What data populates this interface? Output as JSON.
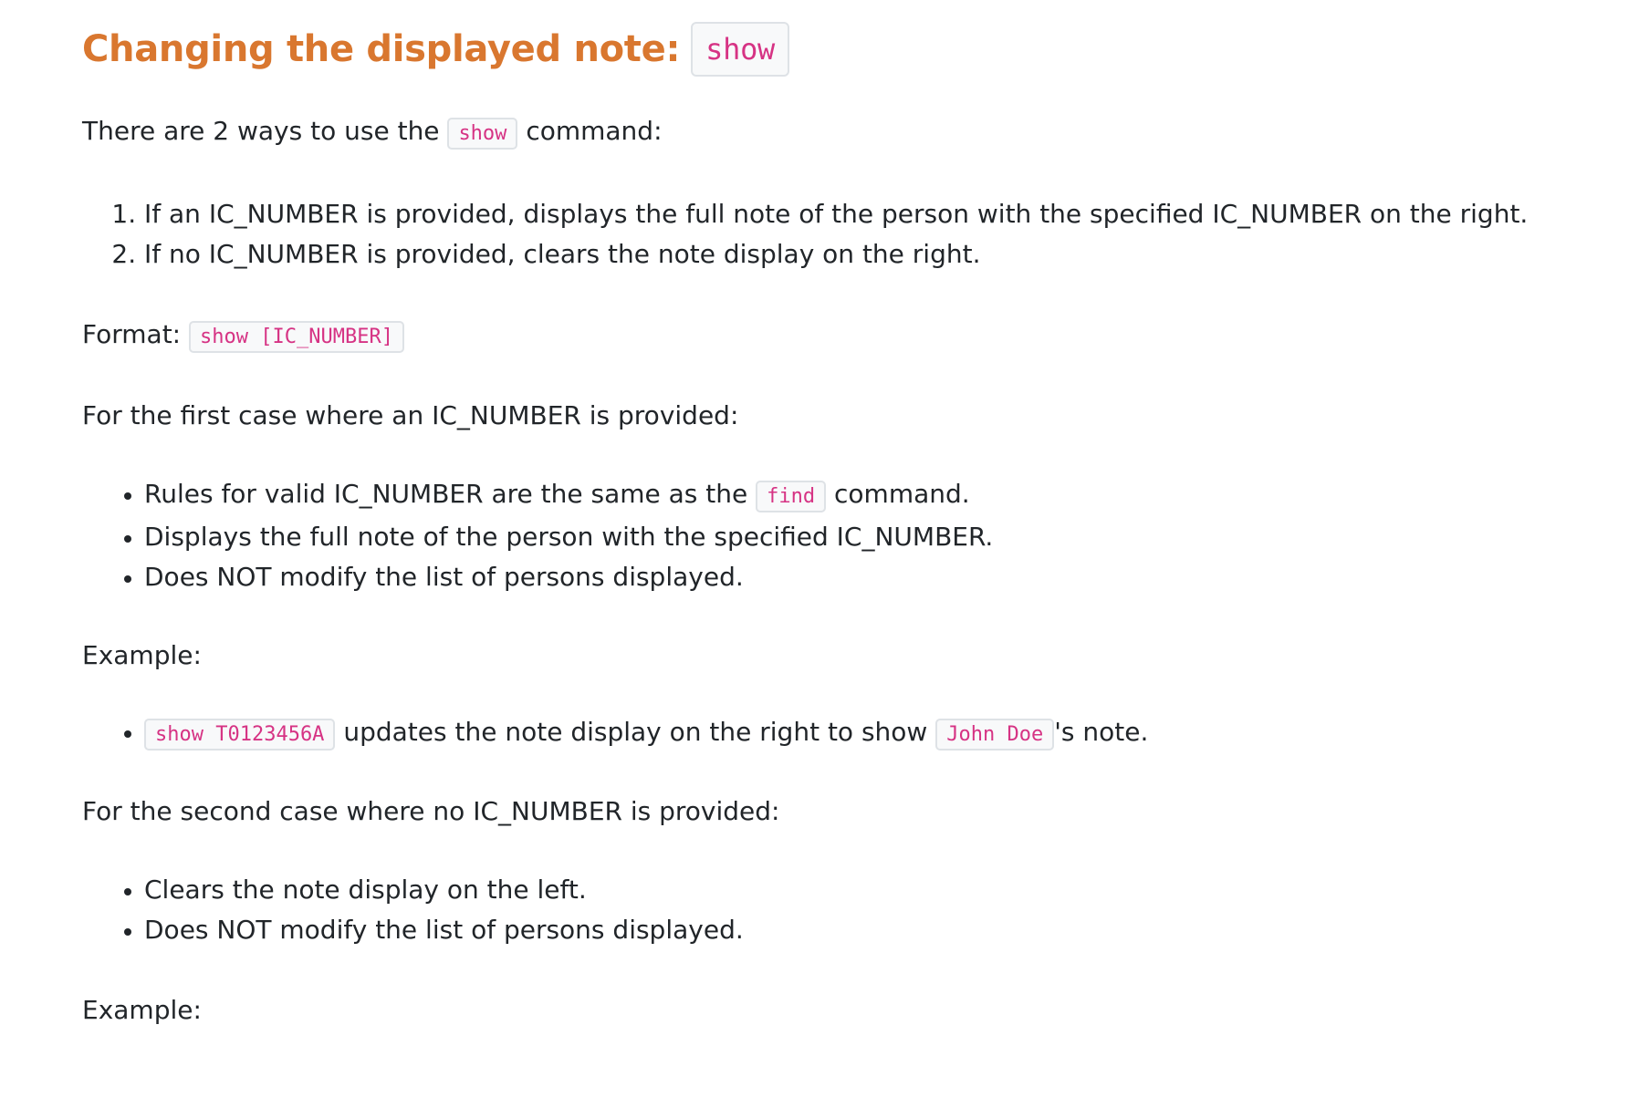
{
  "heading": {
    "text": "Changing the displayed note: ",
    "code": "show"
  },
  "intro": {
    "before": "There are 2 ways to use the ",
    "code": "show",
    "after": " command:"
  },
  "ways": [
    "If an IC_NUMBER is provided, displays the full note of the person with the specified IC_NUMBER on the right.",
    "If no IC_NUMBER is provided, clears the note display on the right."
  ],
  "format": {
    "label": "Format: ",
    "code": "show [IC_NUMBER]"
  },
  "case1": {
    "intro": "For the first case where an IC_NUMBER is provided:",
    "rule1_before": "Rules for valid IC_NUMBER are the same as the ",
    "rule1_code": "find",
    "rule1_after": " command.",
    "rule2": "Displays the full note of the person with the specified IC_NUMBER.",
    "rule3": "Does NOT modify the list of persons displayed.",
    "example_label": "Example:",
    "example_code": "show T0123456A",
    "example_middle": " updates the note display on the right to show ",
    "example_name_code": "John Doe",
    "example_after": "'s note."
  },
  "case2": {
    "intro": "For the second case where no IC_NUMBER is provided:",
    "rule1": "Clears the note display on the left.",
    "rule2": "Does NOT modify the list of persons displayed.",
    "example_label": "Example:"
  }
}
